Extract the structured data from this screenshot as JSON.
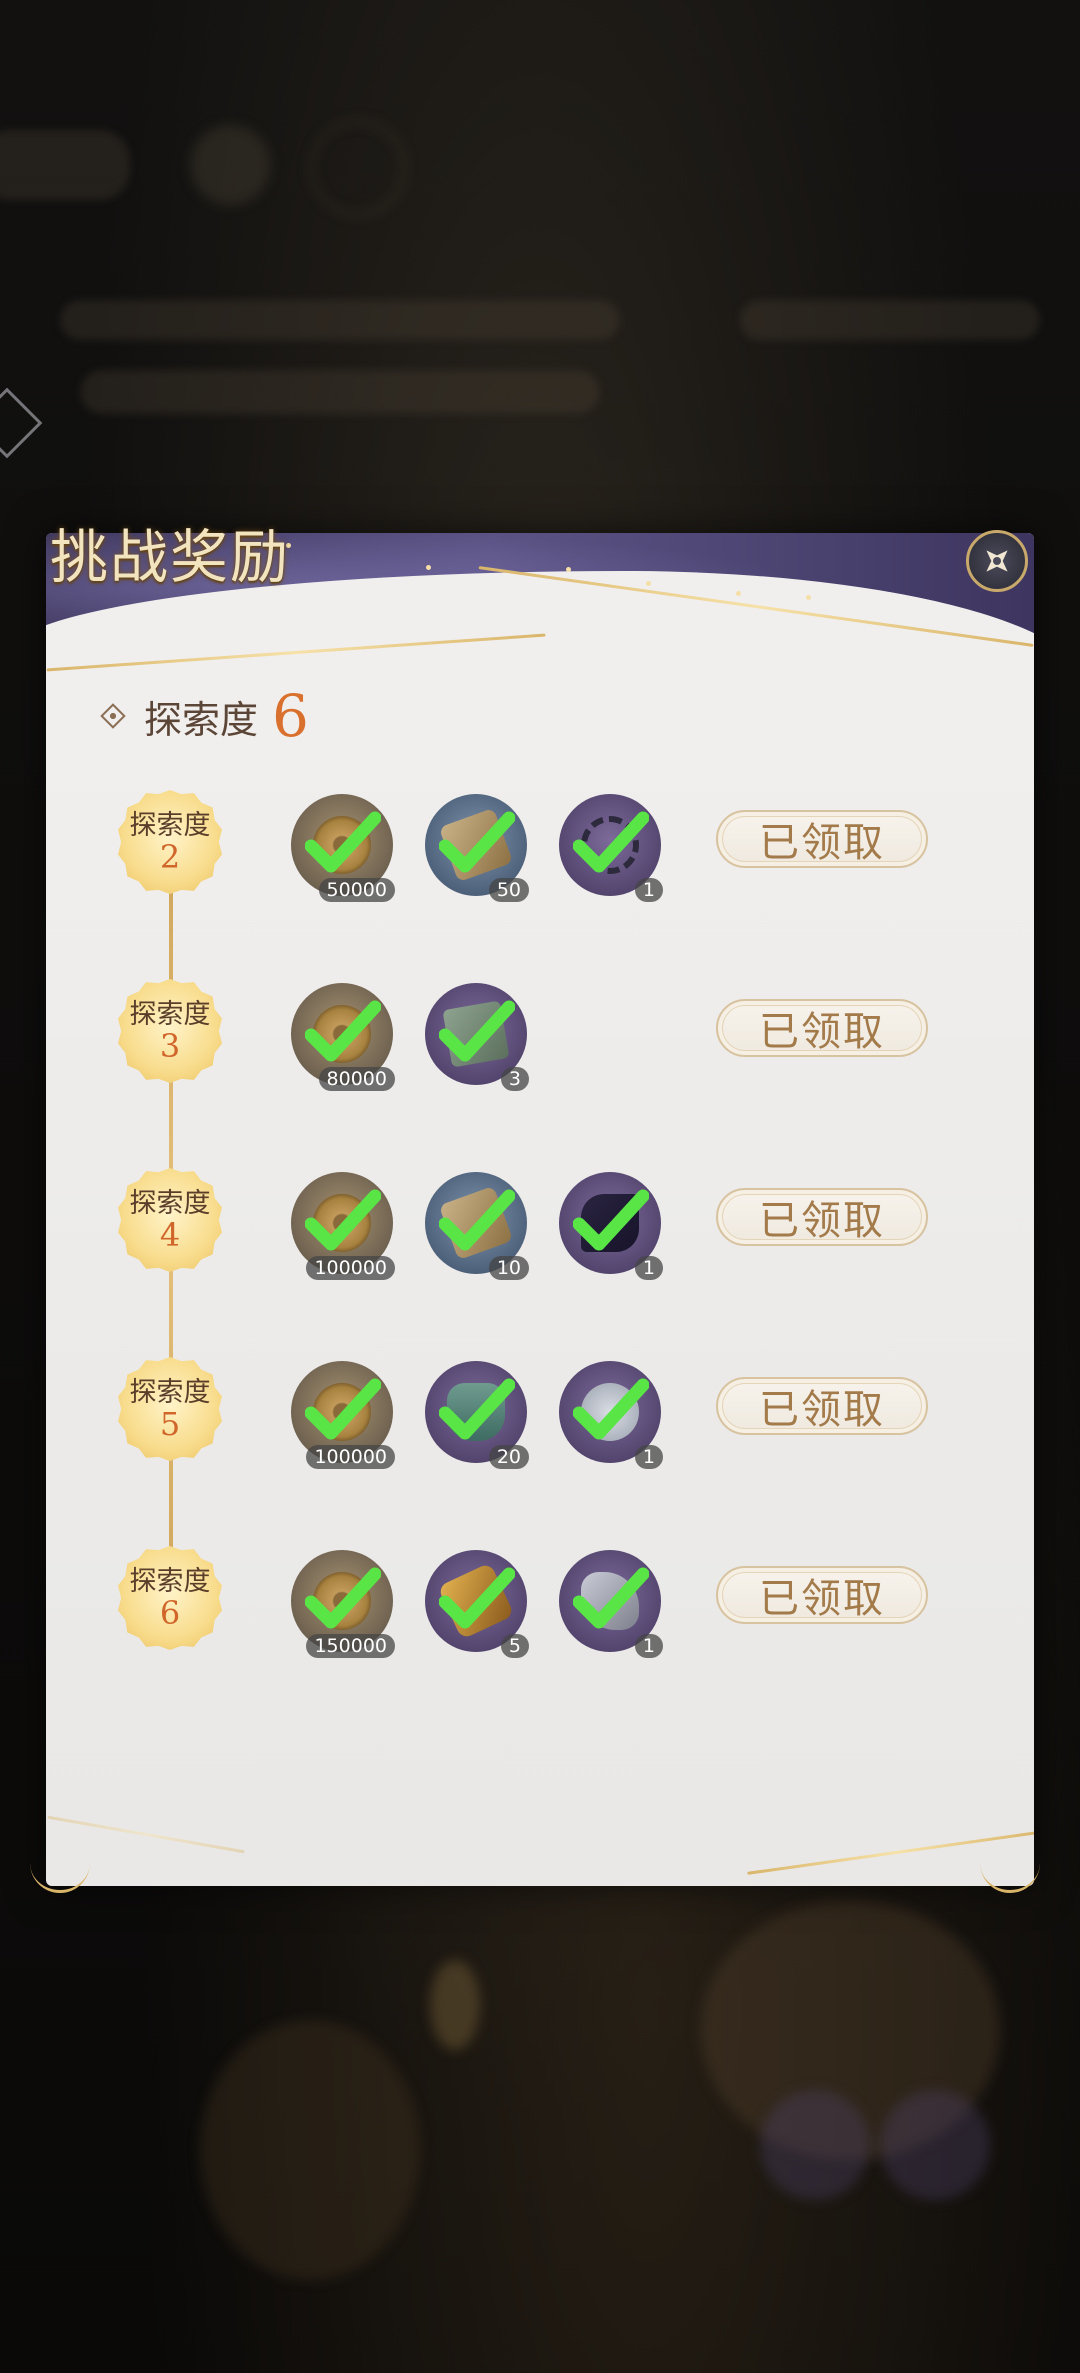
{
  "dialog": {
    "title": "挑战奖励",
    "close_icon": "close-icon"
  },
  "exploration": {
    "label": "探索度",
    "value": "6"
  },
  "tiers": [
    {
      "badge_label": "探索度",
      "level": "2",
      "button_label": "已领取",
      "rewards": [
        {
          "icon": "coin-icon",
          "qty": "50000",
          "claimed": true
        },
        {
          "icon": "scroll-icon",
          "qty": "50",
          "claimed": true
        },
        {
          "icon": "ring-icon",
          "qty": "1",
          "claimed": true
        }
      ]
    },
    {
      "badge_label": "探索度",
      "level": "3",
      "button_label": "已领取",
      "rewards": [
        {
          "icon": "coin-icon",
          "qty": "80000",
          "claimed": true
        },
        {
          "icon": "book-icon",
          "qty": "3",
          "claimed": true
        }
      ]
    },
    {
      "badge_label": "探索度",
      "level": "4",
      "button_label": "已领取",
      "rewards": [
        {
          "icon": "coin-icon",
          "qty": "100000",
          "claimed": true
        },
        {
          "icon": "scroll-icon",
          "qty": "10",
          "claimed": true
        },
        {
          "icon": "blade-icon",
          "qty": "1",
          "claimed": true
        }
      ]
    },
    {
      "badge_label": "探索度",
      "level": "5",
      "button_label": "已领取",
      "rewards": [
        {
          "icon": "coin-icon",
          "qty": "100000",
          "claimed": true
        },
        {
          "icon": "vase-icon",
          "qty": "20",
          "claimed": true
        },
        {
          "icon": "doll-icon",
          "qty": "1",
          "claimed": true
        }
      ]
    },
    {
      "badge_label": "探索度",
      "level": "6",
      "button_label": "已领取",
      "rewards": [
        {
          "icon": "coin-icon",
          "qty": "150000",
          "claimed": true
        },
        {
          "icon": "gold-bar-icon",
          "qty": "5",
          "claimed": true
        },
        {
          "icon": "hook-icon",
          "qty": "1",
          "claimed": true
        }
      ]
    }
  ],
  "colors": {
    "accent_orange": "#d9702d",
    "gold": "#d9b56a",
    "check_green": "#59e545",
    "header_purple": "#4b4470"
  }
}
